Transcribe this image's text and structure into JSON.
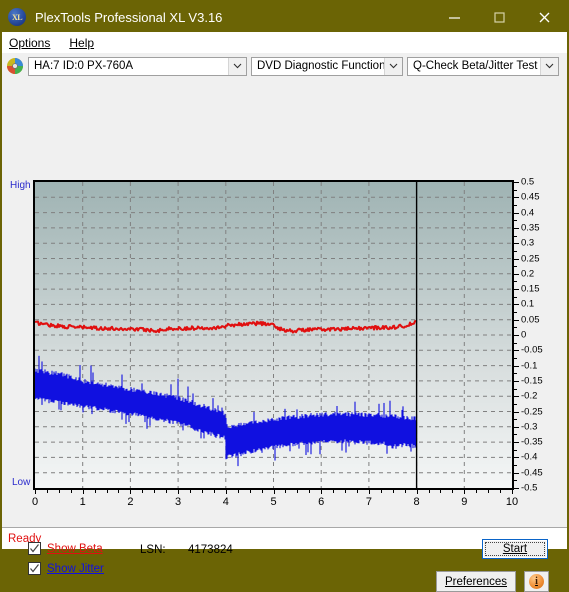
{
  "window": {
    "title": "PlexTools Professional XL V3.16",
    "app_icon": "xl-logo-icon",
    "minimize_label": "─",
    "maximize_label": "□",
    "close_label": "✕",
    "titlebar_color": "#6b6405"
  },
  "menu": {
    "items": [
      {
        "label": "Options"
      },
      {
        "label": "Help"
      }
    ]
  },
  "toolbar": {
    "disc_icon": "disc-drive-icon",
    "drive_select": {
      "value": "HA:7 ID:0  PX-760A"
    },
    "function_select": {
      "value": "DVD Diagnostic Functions"
    },
    "test_select": {
      "value": "Q-Check Beta/Jitter Test"
    }
  },
  "controls": {
    "show_beta": {
      "label": "Show Beta",
      "checked": true,
      "color": "#e01010"
    },
    "show_jitter": {
      "label": "Show Jitter",
      "checked": true,
      "color": "#1010e0"
    },
    "lsn_label": "LSN:",
    "lsn_value": "4173824",
    "start_button": "Start",
    "preferences_button": "Preferences",
    "info_button": "i"
  },
  "status": {
    "text": "Ready",
    "color": "#e01010"
  },
  "chart_data": {
    "type": "line",
    "title": "",
    "xlabel": "",
    "ylabel": "",
    "xlim": [
      0,
      10
    ],
    "ylim": [
      -0.5,
      0.5
    ],
    "xticks": [
      0,
      1,
      2,
      3,
      4,
      5,
      6,
      7,
      8,
      9,
      10
    ],
    "yticks": [
      0.5,
      0.45,
      0.4,
      0.35,
      0.3,
      0.25,
      0.2,
      0.15,
      0.1,
      0.05,
      0,
      -0.05,
      -0.1,
      -0.15,
      -0.2,
      -0.25,
      -0.3,
      -0.35,
      -0.4,
      -0.45,
      -0.5
    ],
    "grid": true,
    "y_axis_top_label": "High",
    "y_axis_bottom_label": "Low",
    "data_end_marker_x": 8,
    "legend_position": "below-plot",
    "series": [
      {
        "name": "Beta",
        "color": "#e01010",
        "type": "line",
        "x": [
          0.0,
          0.2,
          0.4,
          0.6,
          0.8,
          1.0,
          1.2,
          1.4,
          1.6,
          1.8,
          2.0,
          2.2,
          2.4,
          2.6,
          2.8,
          3.0,
          3.2,
          3.4,
          3.6,
          3.8,
          3.99,
          4.0,
          4.2,
          4.4,
          4.6,
          4.8,
          5.0,
          5.2,
          5.4,
          5.6,
          5.8,
          6.0,
          6.2,
          6.4,
          6.6,
          6.8,
          7.0,
          7.2,
          7.4,
          7.6,
          7.8,
          8.0
        ],
        "values": [
          0.04,
          0.036,
          0.031,
          0.028,
          0.026,
          0.025,
          0.023,
          0.022,
          0.021,
          0.02,
          0.02,
          0.019,
          0.016,
          0.015,
          0.02,
          0.021,
          0.022,
          0.023,
          0.024,
          0.025,
          0.027,
          0.031,
          0.034,
          0.036,
          0.038,
          0.038,
          0.031,
          0.016,
          0.014,
          0.016,
          0.018,
          0.018,
          0.019,
          0.019,
          0.02,
          0.022,
          0.023,
          0.024,
          0.025,
          0.026,
          0.032,
          0.042
        ]
      },
      {
        "name": "Jitter",
        "color": "#1010e0",
        "type": "band",
        "x": [
          0.0,
          0.2,
          0.4,
          0.6,
          0.8,
          1.0,
          1.2,
          1.4,
          1.6,
          1.8,
          2.0,
          2.2,
          2.4,
          2.6,
          2.8,
          3.0,
          3.2,
          3.4,
          3.6,
          3.8,
          3.99,
          4.0,
          4.2,
          4.4,
          4.6,
          4.8,
          5.0,
          5.2,
          5.4,
          5.6,
          5.8,
          6.0,
          6.2,
          6.4,
          6.6,
          6.8,
          7.0,
          7.2,
          7.4,
          7.6,
          7.8,
          8.0
        ],
        "upper": [
          -0.115,
          -0.12,
          -0.125,
          -0.13,
          -0.14,
          -0.15,
          -0.155,
          -0.16,
          -0.168,
          -0.172,
          -0.178,
          -0.182,
          -0.188,
          -0.195,
          -0.2,
          -0.205,
          -0.215,
          -0.225,
          -0.235,
          -0.248,
          -0.255,
          -0.3,
          -0.295,
          -0.29,
          -0.285,
          -0.28,
          -0.275,
          -0.272,
          -0.268,
          -0.265,
          -0.262,
          -0.26,
          -0.258,
          -0.258,
          -0.258,
          -0.26,
          -0.262,
          -0.263,
          -0.265,
          -0.268,
          -0.27,
          -0.272
        ],
        "lower": [
          -0.205,
          -0.212,
          -0.218,
          -0.222,
          -0.228,
          -0.232,
          -0.238,
          -0.242,
          -0.248,
          -0.252,
          -0.258,
          -0.262,
          -0.268,
          -0.275,
          -0.282,
          -0.288,
          -0.298,
          -0.308,
          -0.318,
          -0.328,
          -0.335,
          -0.4,
          -0.392,
          -0.385,
          -0.378,
          -0.372,
          -0.366,
          -0.362,
          -0.358,
          -0.355,
          -0.352,
          -0.35,
          -0.348,
          -0.348,
          -0.348,
          -0.35,
          -0.352,
          -0.354,
          -0.356,
          -0.358,
          -0.36,
          -0.362
        ]
      }
    ]
  }
}
